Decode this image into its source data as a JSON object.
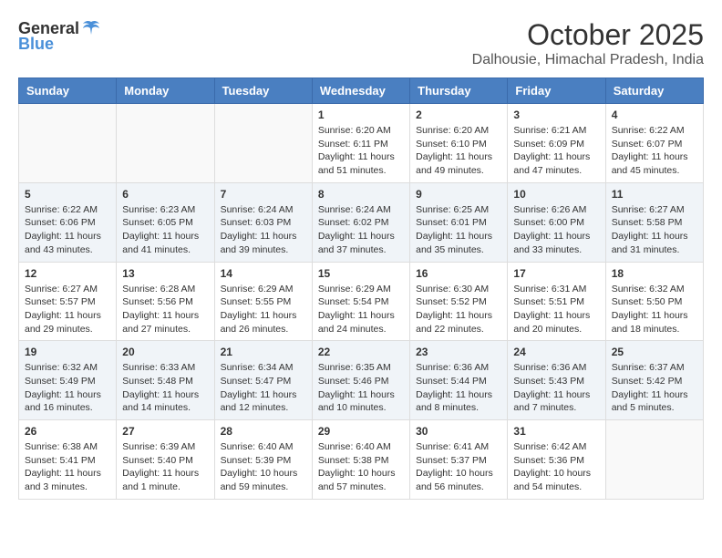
{
  "header": {
    "logo_general": "General",
    "logo_blue": "Blue",
    "month_title": "October 2025",
    "location": "Dalhousie, Himachal Pradesh, India"
  },
  "weekdays": [
    "Sunday",
    "Monday",
    "Tuesday",
    "Wednesday",
    "Thursday",
    "Friday",
    "Saturday"
  ],
  "weeks": [
    [
      {
        "day": "",
        "info": ""
      },
      {
        "day": "",
        "info": ""
      },
      {
        "day": "",
        "info": ""
      },
      {
        "day": "1",
        "info": "Sunrise: 6:20 AM\nSunset: 6:11 PM\nDaylight: 11 hours\nand 51 minutes."
      },
      {
        "day": "2",
        "info": "Sunrise: 6:20 AM\nSunset: 6:10 PM\nDaylight: 11 hours\nand 49 minutes."
      },
      {
        "day": "3",
        "info": "Sunrise: 6:21 AM\nSunset: 6:09 PM\nDaylight: 11 hours\nand 47 minutes."
      },
      {
        "day": "4",
        "info": "Sunrise: 6:22 AM\nSunset: 6:07 PM\nDaylight: 11 hours\nand 45 minutes."
      }
    ],
    [
      {
        "day": "5",
        "info": "Sunrise: 6:22 AM\nSunset: 6:06 PM\nDaylight: 11 hours\nand 43 minutes."
      },
      {
        "day": "6",
        "info": "Sunrise: 6:23 AM\nSunset: 6:05 PM\nDaylight: 11 hours\nand 41 minutes."
      },
      {
        "day": "7",
        "info": "Sunrise: 6:24 AM\nSunset: 6:03 PM\nDaylight: 11 hours\nand 39 minutes."
      },
      {
        "day": "8",
        "info": "Sunrise: 6:24 AM\nSunset: 6:02 PM\nDaylight: 11 hours\nand 37 minutes."
      },
      {
        "day": "9",
        "info": "Sunrise: 6:25 AM\nSunset: 6:01 PM\nDaylight: 11 hours\nand 35 minutes."
      },
      {
        "day": "10",
        "info": "Sunrise: 6:26 AM\nSunset: 6:00 PM\nDaylight: 11 hours\nand 33 minutes."
      },
      {
        "day": "11",
        "info": "Sunrise: 6:27 AM\nSunset: 5:58 PM\nDaylight: 11 hours\nand 31 minutes."
      }
    ],
    [
      {
        "day": "12",
        "info": "Sunrise: 6:27 AM\nSunset: 5:57 PM\nDaylight: 11 hours\nand 29 minutes."
      },
      {
        "day": "13",
        "info": "Sunrise: 6:28 AM\nSunset: 5:56 PM\nDaylight: 11 hours\nand 27 minutes."
      },
      {
        "day": "14",
        "info": "Sunrise: 6:29 AM\nSunset: 5:55 PM\nDaylight: 11 hours\nand 26 minutes."
      },
      {
        "day": "15",
        "info": "Sunrise: 6:29 AM\nSunset: 5:54 PM\nDaylight: 11 hours\nand 24 minutes."
      },
      {
        "day": "16",
        "info": "Sunrise: 6:30 AM\nSunset: 5:52 PM\nDaylight: 11 hours\nand 22 minutes."
      },
      {
        "day": "17",
        "info": "Sunrise: 6:31 AM\nSunset: 5:51 PM\nDaylight: 11 hours\nand 20 minutes."
      },
      {
        "day": "18",
        "info": "Sunrise: 6:32 AM\nSunset: 5:50 PM\nDaylight: 11 hours\nand 18 minutes."
      }
    ],
    [
      {
        "day": "19",
        "info": "Sunrise: 6:32 AM\nSunset: 5:49 PM\nDaylight: 11 hours\nand 16 minutes."
      },
      {
        "day": "20",
        "info": "Sunrise: 6:33 AM\nSunset: 5:48 PM\nDaylight: 11 hours\nand 14 minutes."
      },
      {
        "day": "21",
        "info": "Sunrise: 6:34 AM\nSunset: 5:47 PM\nDaylight: 11 hours\nand 12 minutes."
      },
      {
        "day": "22",
        "info": "Sunrise: 6:35 AM\nSunset: 5:46 PM\nDaylight: 11 hours\nand 10 minutes."
      },
      {
        "day": "23",
        "info": "Sunrise: 6:36 AM\nSunset: 5:44 PM\nDaylight: 11 hours\nand 8 minutes."
      },
      {
        "day": "24",
        "info": "Sunrise: 6:36 AM\nSunset: 5:43 PM\nDaylight: 11 hours\nand 7 minutes."
      },
      {
        "day": "25",
        "info": "Sunrise: 6:37 AM\nSunset: 5:42 PM\nDaylight: 11 hours\nand 5 minutes."
      }
    ],
    [
      {
        "day": "26",
        "info": "Sunrise: 6:38 AM\nSunset: 5:41 PM\nDaylight: 11 hours\nand 3 minutes."
      },
      {
        "day": "27",
        "info": "Sunrise: 6:39 AM\nSunset: 5:40 PM\nDaylight: 11 hours\nand 1 minute."
      },
      {
        "day": "28",
        "info": "Sunrise: 6:40 AM\nSunset: 5:39 PM\nDaylight: 10 hours\nand 59 minutes."
      },
      {
        "day": "29",
        "info": "Sunrise: 6:40 AM\nSunset: 5:38 PM\nDaylight: 10 hours\nand 57 minutes."
      },
      {
        "day": "30",
        "info": "Sunrise: 6:41 AM\nSunset: 5:37 PM\nDaylight: 10 hours\nand 56 minutes."
      },
      {
        "day": "31",
        "info": "Sunrise: 6:42 AM\nSunset: 5:36 PM\nDaylight: 10 hours\nand 54 minutes."
      },
      {
        "day": "",
        "info": ""
      }
    ]
  ]
}
